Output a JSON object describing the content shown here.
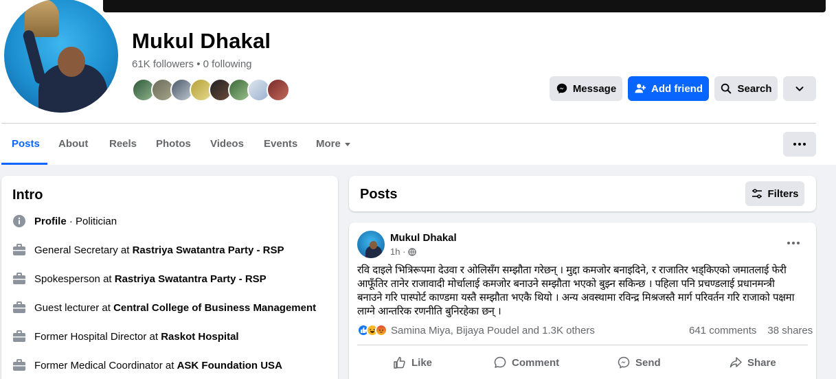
{
  "profile": {
    "name": "Mukul Dhakal",
    "followers_text": "61K followers • 0 following"
  },
  "buttons": {
    "message": "Message",
    "add_friend": "Add friend",
    "search": "Search"
  },
  "tabs": [
    {
      "label": "Posts",
      "active": true
    },
    {
      "label": "About"
    },
    {
      "label": "Reels"
    },
    {
      "label": "Photos"
    },
    {
      "label": "Videos"
    },
    {
      "label": "Events"
    },
    {
      "label": "More"
    }
  ],
  "intro": {
    "title": "Intro",
    "profile_label": "Profile",
    "profile_sep": " · ",
    "profile_value": "Politician",
    "items": [
      {
        "prefix": "General Secretary at ",
        "org": "Rastriya Swatantra Party - RSP"
      },
      {
        "prefix": "Spokesperson at ",
        "org": "Rastriya Swatantra Party - RSP"
      },
      {
        "prefix": "Guest lecturer at ",
        "org": "Central College of Business Management"
      },
      {
        "prefix": "Former Hospital Director at ",
        "org": "Raskot Hospital"
      },
      {
        "prefix": "Former Medical Coordinator at ",
        "org": "ASK Foundation USA"
      }
    ]
  },
  "posts_header": {
    "title": "Posts",
    "filters": "Filters"
  },
  "post": {
    "author": "Mukul Dhakal",
    "time": "1h ·",
    "text": "रवि दाइले भित्रिरूपमा देउवा र ओलिसँग सम्झौता गरेछन् । मुद्दा कमजोर बनाइदिने, र राजातिर भड्किएको जमातलाई फेरी आफूँतिर तानेर राजावादी मोर्चालाई कमजोर बनाउने सम्झौता भएको बुझ्न सकिन्छ । पहिला पनि प्रचण्डलाई प्रधानमन्त्री बनाउने गरि पास्पोर्ट काण्डमा यस्तै सम्झौता भएकै थियो । अन्य अवस्थामा रविन्द्र मिश्रजस्तै मार्ग परिवर्तन गरि राजाको पक्षमा लाग्ने आन्तरिक रणनीति बुनिरहेका छन् ।",
    "reactions_text": "Samina Miya, Bijaya Poudel and 1.3K others",
    "comments": "641 comments",
    "shares": "38 shares",
    "actions": {
      "like": "Like",
      "comment": "Comment",
      "send": "Send",
      "share": "Share"
    }
  },
  "colors": {
    "accent": "#0866ff",
    "secondary_text": "#65676b",
    "button_grey": "#e4e6eb"
  }
}
